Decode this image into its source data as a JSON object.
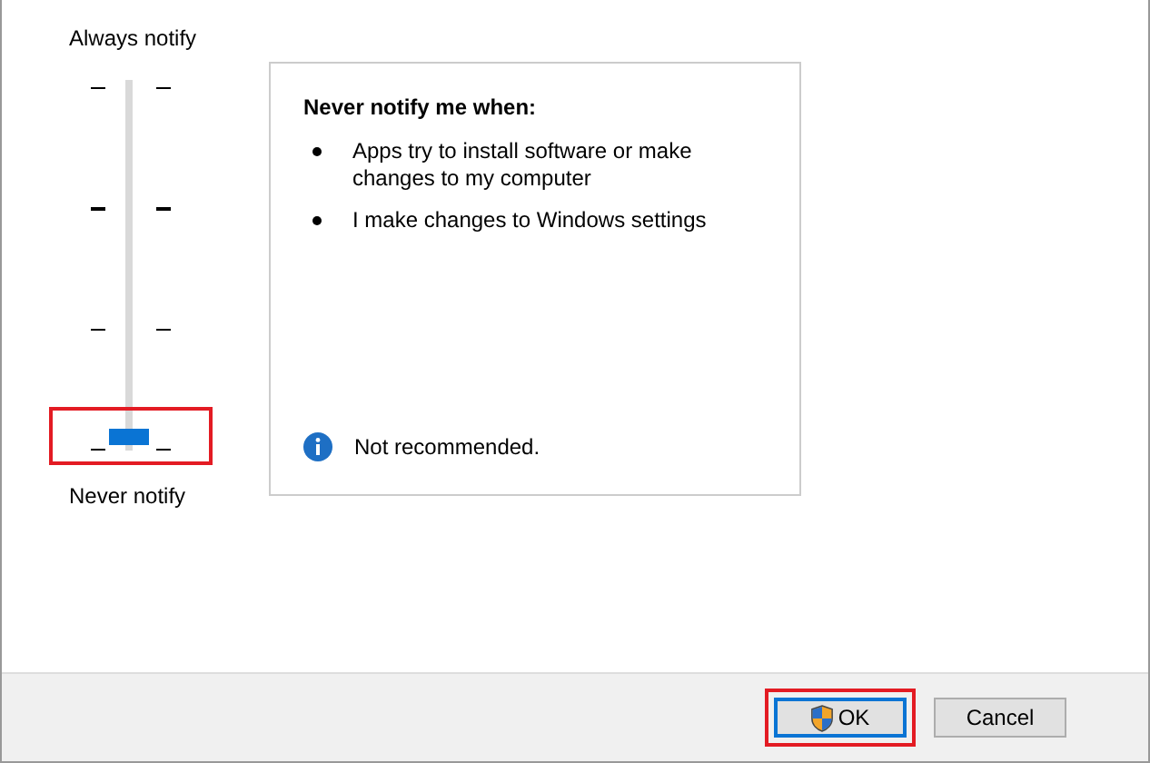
{
  "slider": {
    "top_label": "Always notify",
    "bottom_label": "Never notify",
    "level": 0
  },
  "panel": {
    "heading": "Never notify me when:",
    "bullets": [
      "Apps try to install software or make changes to my computer",
      "I make changes to Windows settings"
    ],
    "note": "Not recommended."
  },
  "buttons": [
    {
      "label": "OK",
      "default": true,
      "shield": true
    },
    {
      "label": "Cancel",
      "default": false,
      "shield": false
    }
  ]
}
